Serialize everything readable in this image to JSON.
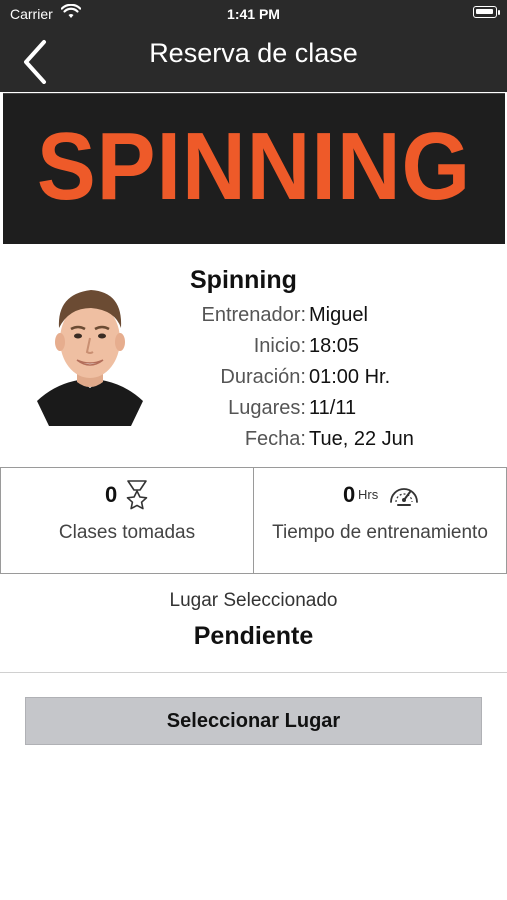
{
  "status_bar": {
    "carrier": "Carrier",
    "time": "1:41 PM"
  },
  "nav": {
    "title": "Reserva de clase",
    "back_icon": "chevron-left-icon"
  },
  "banner": {
    "text": "SPINNING",
    "color": "#ee5a29"
  },
  "class_info": {
    "name": "Spinning",
    "rows": [
      {
        "label": "Entrenador:",
        "value": "Miguel"
      },
      {
        "label": "Inicio:",
        "value": "18:05"
      },
      {
        "label": "Duración:",
        "value": "01:00 Hr."
      },
      {
        "label": "Lugares:",
        "value": "11/11"
      },
      {
        "label": "Fecha:",
        "value": "Tue, 22 Jun"
      }
    ]
  },
  "stats": {
    "classes": {
      "value": "0",
      "label": "Clases tomadas",
      "icon": "star-medal-icon"
    },
    "training": {
      "value": "0",
      "unit": "Hrs",
      "label": "Tiempo de entrenamiento",
      "icon": "speedometer-icon"
    }
  },
  "selected_place": {
    "caption": "Lugar Seleccionado",
    "value": "Pendiente"
  },
  "actions": {
    "select_place": "Seleccionar Lugar"
  }
}
